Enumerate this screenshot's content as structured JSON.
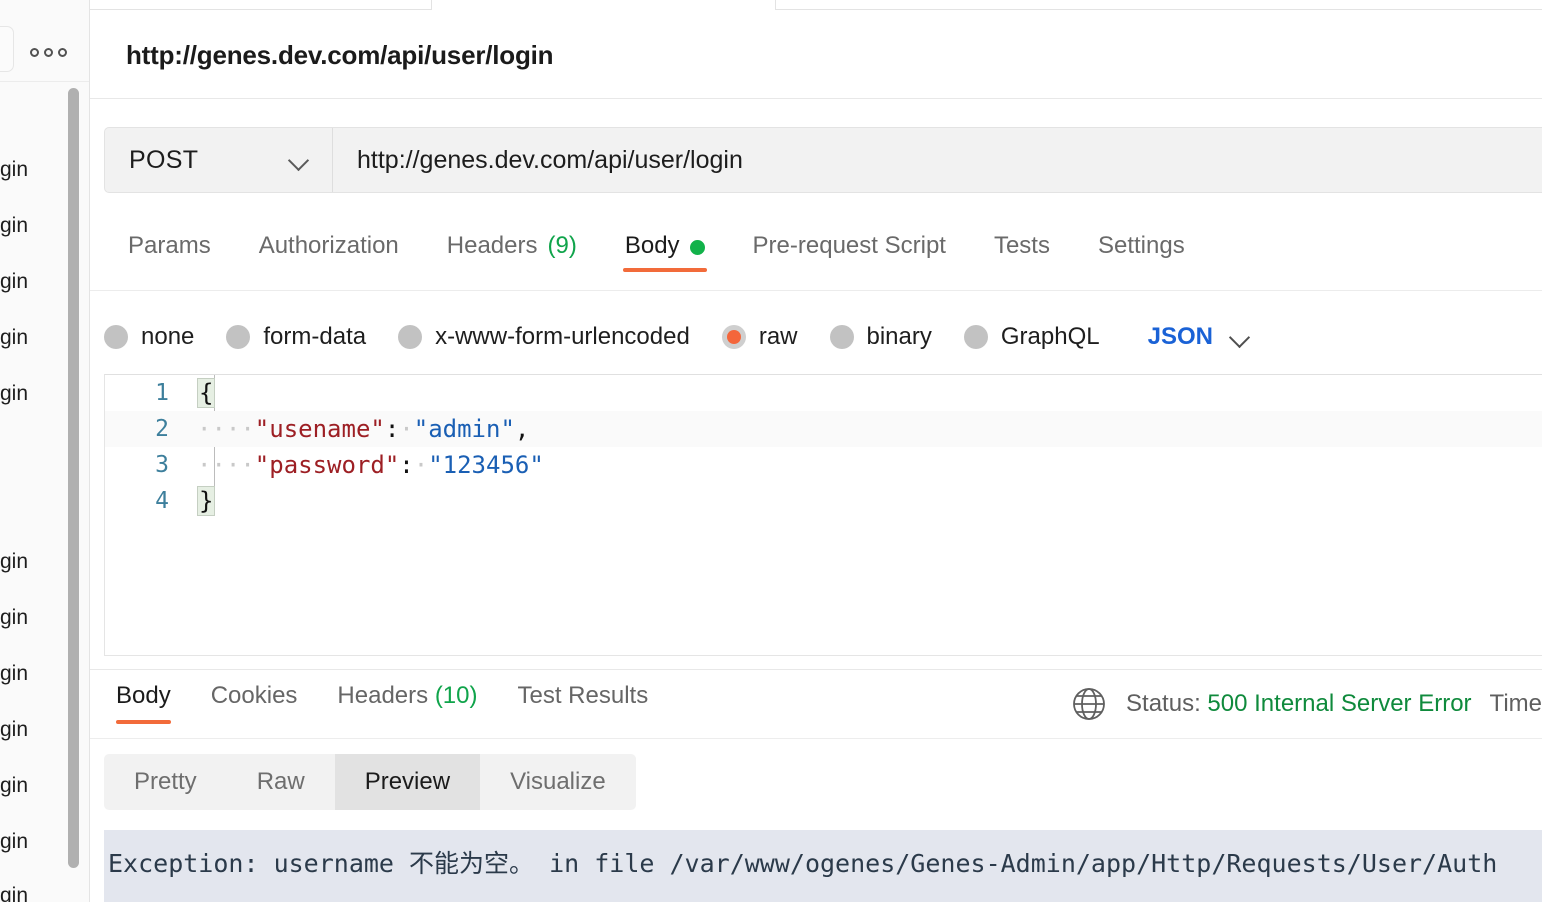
{
  "sidebar": {
    "more_icon": "more-horizontal-icon",
    "items": [
      {
        "label": "gin"
      },
      {
        "label": "gin"
      },
      {
        "label": "gin"
      },
      {
        "label": "gin"
      },
      {
        "label": "gin"
      },
      {
        "label": "gin"
      },
      {
        "label": "gin"
      },
      {
        "label": "gin"
      },
      {
        "label": "gin"
      },
      {
        "label": "gin"
      },
      {
        "label": "gin"
      },
      {
        "label": "gin"
      }
    ]
  },
  "request": {
    "title": "http://genes.dev.com/api/user/login",
    "method": "POST",
    "url": "http://genes.dev.com/api/user/login",
    "tabs": [
      {
        "label": "Params",
        "count": "",
        "active": false,
        "dot": false
      },
      {
        "label": "Authorization",
        "count": "",
        "active": false,
        "dot": false
      },
      {
        "label": "Headers",
        "count": "(9)",
        "active": false,
        "dot": false
      },
      {
        "label": "Body",
        "count": "",
        "active": true,
        "dot": true
      },
      {
        "label": "Pre-request Script",
        "count": "",
        "active": false,
        "dot": false
      },
      {
        "label": "Tests",
        "count": "",
        "active": false,
        "dot": false
      },
      {
        "label": "Settings",
        "count": "",
        "active": false,
        "dot": false
      }
    ],
    "body_types": [
      {
        "label": "none",
        "selected": false
      },
      {
        "label": "form-data",
        "selected": false
      },
      {
        "label": "x-www-form-urlencoded",
        "selected": false
      },
      {
        "label": "raw",
        "selected": true
      },
      {
        "label": "binary",
        "selected": false
      },
      {
        "label": "GraphQL",
        "selected": false
      }
    ],
    "raw_format": "JSON",
    "editor": {
      "lines": [
        {
          "num": "1",
          "brace": "{",
          "indent": "",
          "key": "",
          "colon": "",
          "value": "",
          "trail": ""
        },
        {
          "num": "2",
          "brace": "",
          "indent": "····",
          "key": "\"usename\"",
          "colon": ":",
          "value": "\"admin\"",
          "trail": ","
        },
        {
          "num": "3",
          "brace": "",
          "indent": "····",
          "key": "\"password\"",
          "colon": ":",
          "value": "\"123456\"",
          "trail": ""
        },
        {
          "num": "4",
          "brace": "}",
          "indent": "",
          "key": "",
          "colon": "",
          "value": "",
          "trail": ""
        }
      ]
    }
  },
  "response": {
    "tabs": [
      {
        "label": "Body",
        "count": "",
        "active": true
      },
      {
        "label": "Cookies",
        "count": "",
        "active": false
      },
      {
        "label": "Headers",
        "count": "(10)",
        "active": false
      },
      {
        "label": "Test Results",
        "count": "",
        "active": false
      }
    ],
    "globe_icon": "globe-icon",
    "status_label": "Status:",
    "status_value": "500 Internal Server Error",
    "time_label": "Time",
    "view_modes": [
      {
        "label": "Pretty",
        "active": false
      },
      {
        "label": "Raw",
        "active": false
      },
      {
        "label": "Preview",
        "active": true
      },
      {
        "label": "Visualize",
        "active": false
      }
    ],
    "preview_text": "Exception: username 不能为空。 in file /var/www/ogenes/Genes-Admin/app/Http/Requests/User/Auth"
  },
  "colors": {
    "accent": "#f26b3a",
    "ok_green": "#12b24a",
    "status_green": "#0f8a3c",
    "link_blue": "#1a62d6"
  }
}
